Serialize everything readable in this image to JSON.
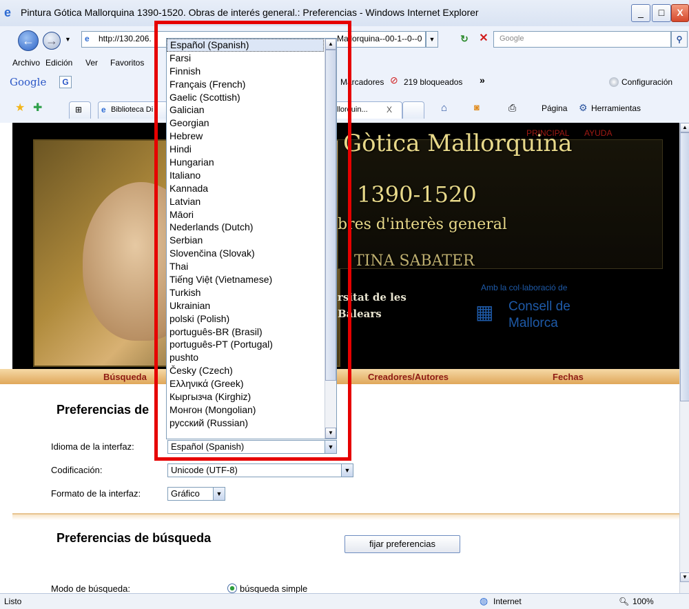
{
  "window": {
    "title": "Pintura Gótica Mallorquina 1390-1520. Obras de interés general.: Preferencias - Windows Internet Explorer",
    "minimize": "_",
    "maximize": "□",
    "close": "X"
  },
  "nav": {
    "address": "http://130.206.",
    "address_tail": "Mallorquina--00-1--0--0",
    "search_placeholder": "Google"
  },
  "menu": {
    "items": [
      "Archivo",
      "Edición",
      "Ver",
      "Favoritos"
    ]
  },
  "google_bar": {
    "logo": "Google",
    "g_button": "G",
    "bookmarks": "Marcadores",
    "blocked": "219 bloqueados",
    "more": "»",
    "settings": "Configuración"
  },
  "tabs": {
    "fav_tab": "Biblioteca Di",
    "active_tab": "llorquin...",
    "tab_close": "X",
    "page_btn": "Página",
    "tools_btn": "Herramientas"
  },
  "banner": {
    "top_links": [
      "PRINCIPAL",
      "AYUDA"
    ],
    "title_line1": "Gòtica Mallorquina",
    "title_line2": "1390-1520",
    "subtitle": "bres d'interès general",
    "author": "TINA SABATER",
    "university": "rsitat de les",
    "university2": "Balears",
    "collab": "Amb la col·laboració de",
    "consell1": "Consell de",
    "consell2": "Mallorca"
  },
  "navbar": {
    "links": [
      "Búsqueda",
      "Creadores/Autores",
      "Fechas"
    ]
  },
  "prefs": {
    "section_title": "Preferencias de",
    "language_label": "Idioma de la interfaz:",
    "language_value": "Español (Spanish)",
    "encoding_label": "Codificación:",
    "encoding_value": "Unicode (UTF-8)",
    "format_label": "Formato de la interfaz:",
    "format_value": "Gráfico",
    "search_title": "Preferencias de búsqueda",
    "set_button": "fijar preferencias",
    "search_mode_label": "Modo de búsqueda:",
    "search_mode_value": "búsqueda simple"
  },
  "dropdown": {
    "options": [
      "Español (Spanish)",
      "Farsi",
      "Finnish",
      "Français (French)",
      "Gaelic (Scottish)",
      "Galician",
      "Georgian",
      "Hebrew",
      "Hindi",
      "Hungarian",
      "Italiano",
      "Kannada",
      "Latvian",
      "Māori",
      "Nederlands (Dutch)",
      "Serbian",
      "Slovenčina (Slovak)",
      "Thai",
      "Tiếng Việt (Vietnamese)",
      "Turkish",
      "Ukrainian",
      "polski (Polish)",
      "português-BR (Brasil)",
      "português-PT (Portugal)",
      "pushto",
      "Česky (Czech)",
      "Ελληνικά (Greek)",
      "Кыргызча (Kirghiz)",
      "Монгон (Mongolian)",
      "русский (Russian)"
    ],
    "selected_index": 0
  },
  "status": {
    "text": "Listo",
    "zone": "Internet",
    "zoom": "100%"
  },
  "colors": {
    "highlight": "#e60000",
    "navlink": "#8e1b14",
    "banner_title": "#e8d98a",
    "consell_blue": "#1e5aa8"
  }
}
